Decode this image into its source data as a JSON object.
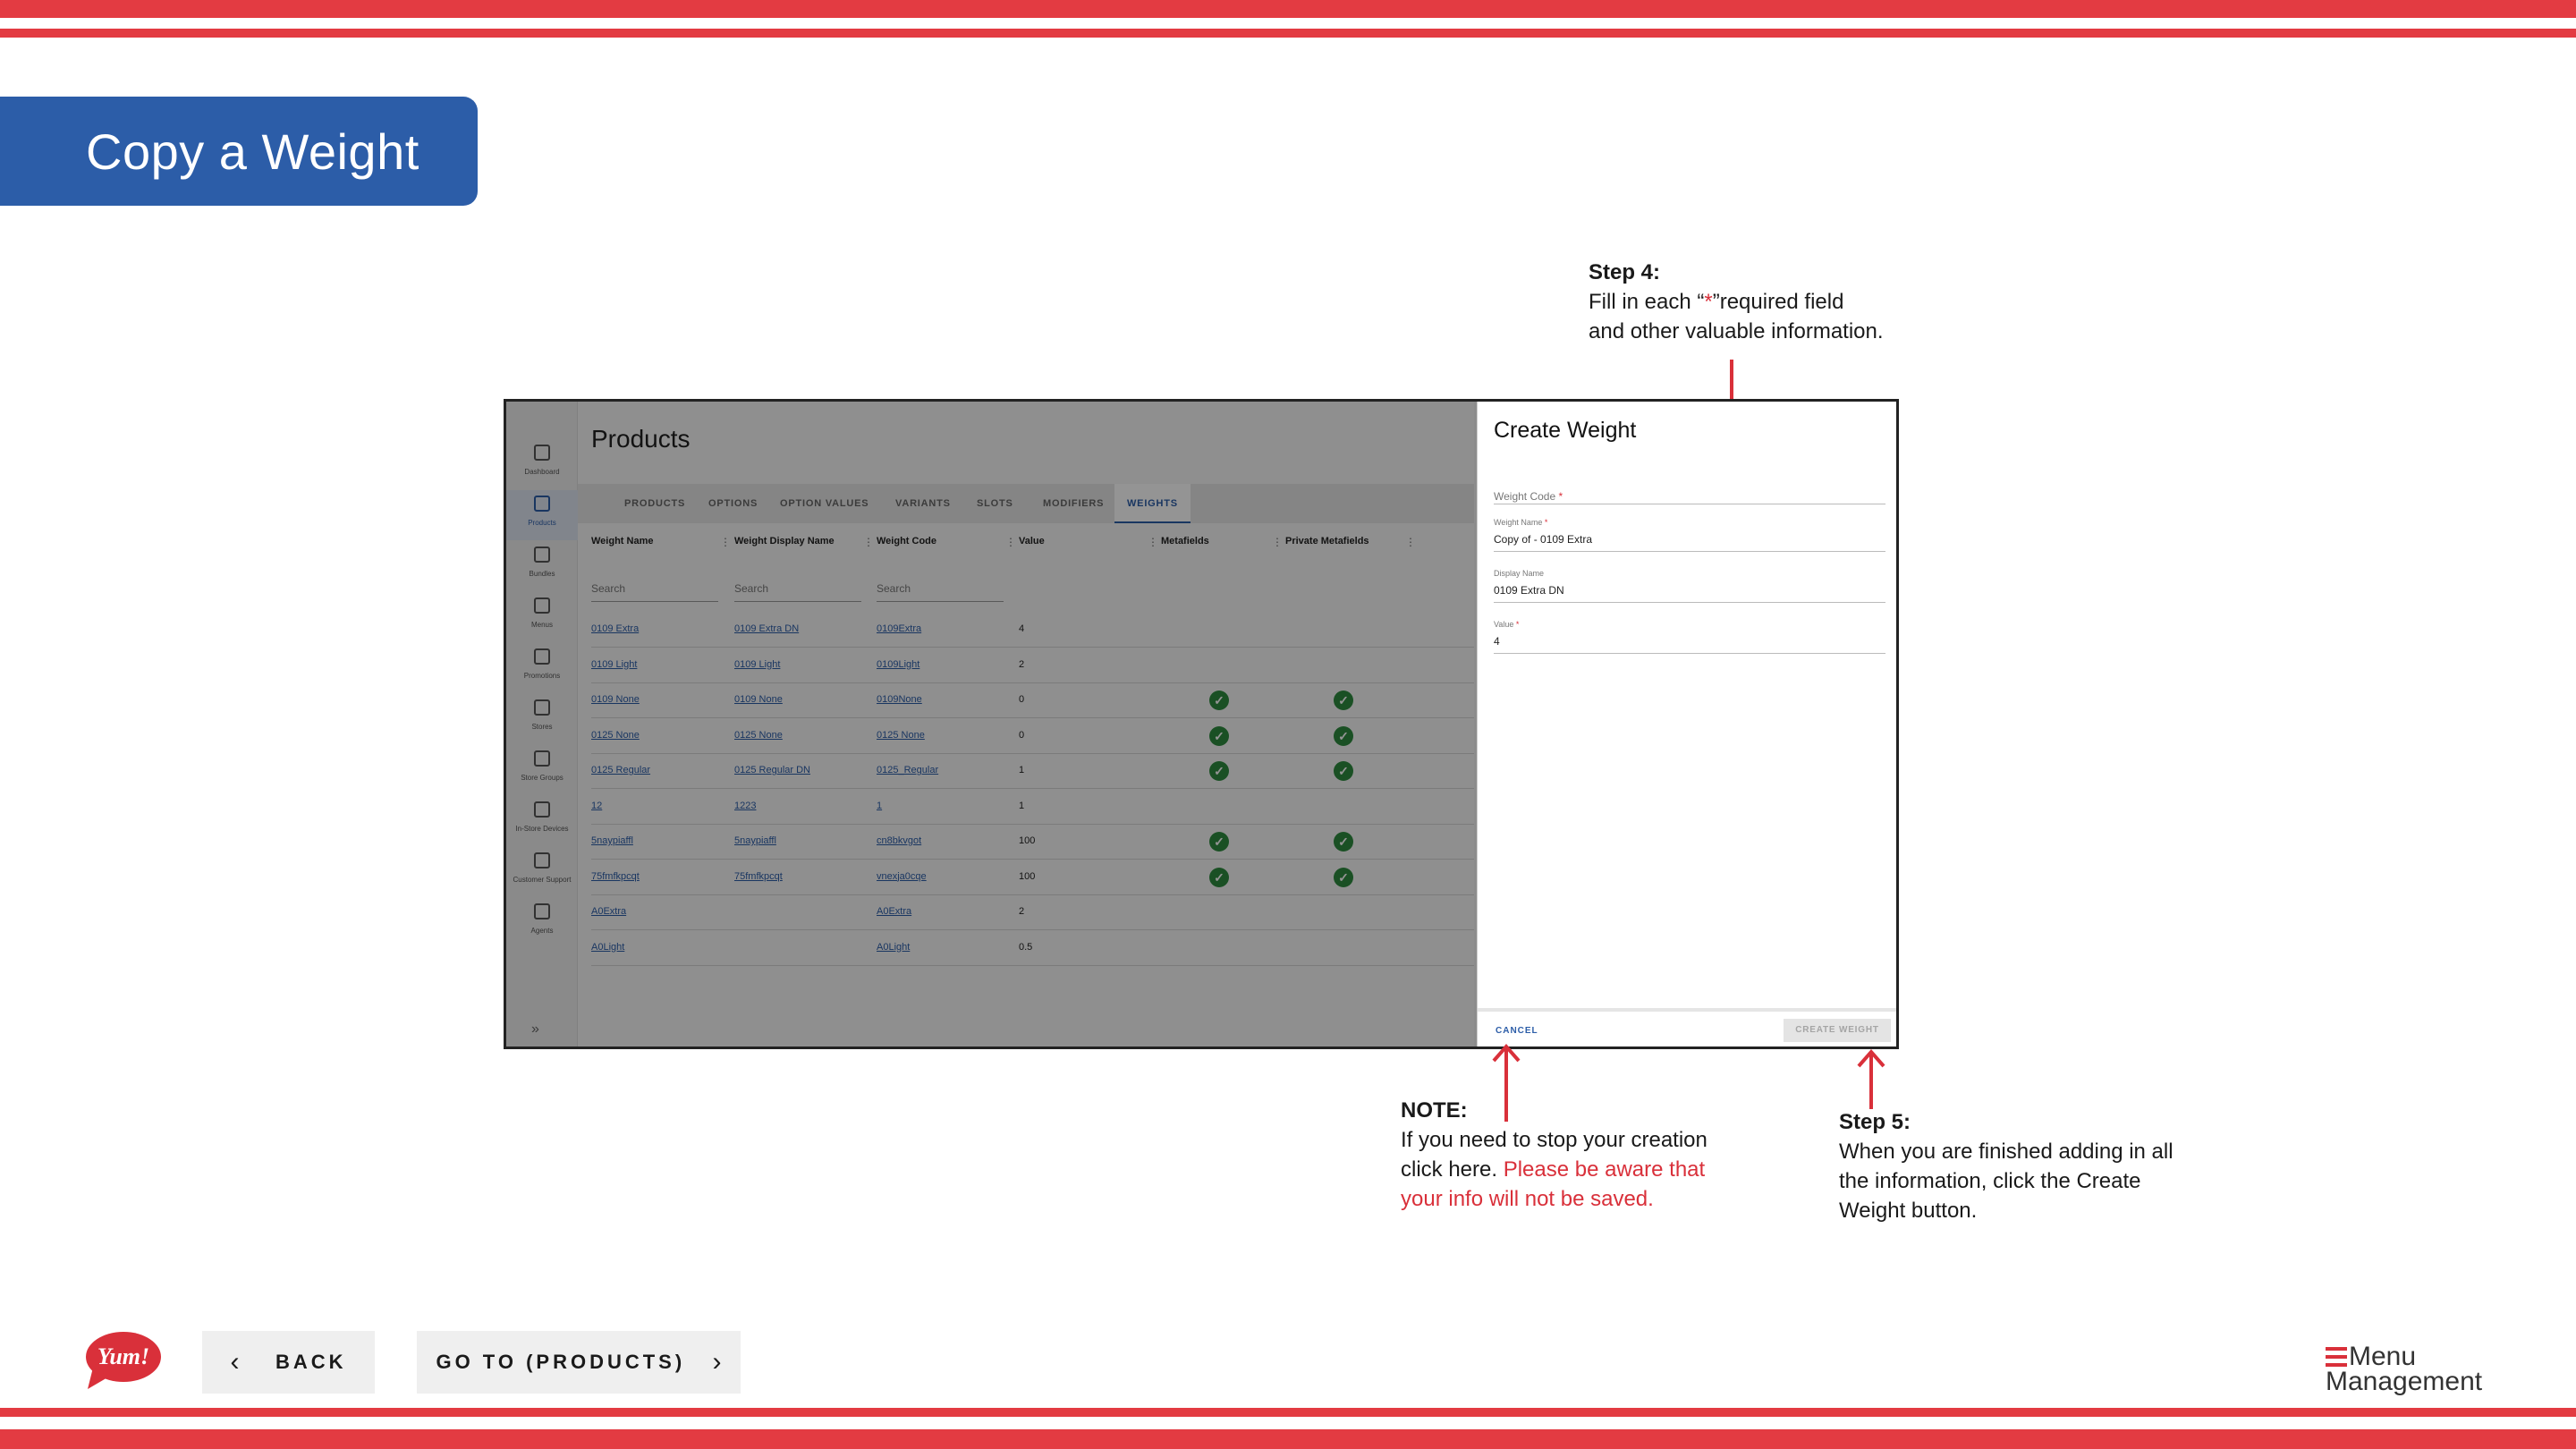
{
  "slide": {
    "title": "Copy a Weight",
    "step4": {
      "heading": "Step 4:",
      "line1_a": "Fill in each “",
      "asterisk": "*",
      "line1_b": "”required field",
      "line2": "and other valuable information."
    },
    "note": {
      "heading": "NOTE:",
      "line1": "If you need to stop your creation",
      "line2_a": "click here. ",
      "line2_b": "Please be aware that",
      "line3": "your info will not be saved."
    },
    "step5": {
      "heading": "Step 5:",
      "line1": "When you are finished adding in all",
      "line2": "the information, click the Create",
      "line3": "Weight button."
    },
    "back_label": "BACK",
    "goto_label": "GO TO (PRODUCTS)",
    "brand_logo": "Yum!",
    "mm_line1": "Menu",
    "mm_line2": "Management"
  },
  "colors": {
    "stripe": "#e33b42",
    "title_bg": "#2c5da8",
    "accent": "#2c5da8",
    "check": "#2e8b3e",
    "note_red": "#d9303a"
  },
  "app": {
    "page_title": "Products",
    "sidebar": [
      {
        "label": "Dashboard",
        "icon": "home-icon"
      },
      {
        "label": "Products",
        "icon": "bag-icon",
        "active": true
      },
      {
        "label": "Bundles",
        "icon": "box-icon"
      },
      {
        "label": "Menus",
        "icon": "document-icon"
      },
      {
        "label": "Promotions",
        "icon": "tag-icon"
      },
      {
        "label": "Stores",
        "icon": "store-icon"
      },
      {
        "label": "Store Groups",
        "icon": "grid-icon"
      },
      {
        "label": "In-Store Devices",
        "icon": "monitor-icon"
      },
      {
        "label": "Customer Support",
        "icon": "support-icon"
      },
      {
        "label": "Agents",
        "icon": "people-icon"
      }
    ],
    "expand_glyph": "»",
    "tabs": [
      "PRODUCTS",
      "OPTIONS",
      "OPTION VALUES",
      "VARIANTS",
      "SLOTS",
      "MODIFIERS",
      "WEIGHTS"
    ],
    "active_tab": "WEIGHTS",
    "columns": [
      "Weight Name",
      "Weight Display Name",
      "Weight Code",
      "Value",
      "Metafields",
      "Private Metafields"
    ],
    "search_placeholder": "Search",
    "rows": [
      {
        "name": "0109 Extra",
        "display": "0109 Extra DN",
        "code": "0109Extra",
        "value": "4",
        "meta": false,
        "pmeta": false
      },
      {
        "name": "0109 Light",
        "display": "0109 Light",
        "code": "0109Light",
        "value": "2",
        "meta": false,
        "pmeta": false
      },
      {
        "name": "0109 None",
        "display": "0109 None",
        "code": "0109None",
        "value": "0",
        "meta": true,
        "pmeta": true
      },
      {
        "name": "0125 None",
        "display": "0125 None",
        "code": "0125 None",
        "value": "0",
        "meta": true,
        "pmeta": true
      },
      {
        "name": "0125 Regular",
        "display": "0125 Regular DN",
        "code": "0125_Regular",
        "value": "1",
        "meta": true,
        "pmeta": true
      },
      {
        "name": "12",
        "display": "1223",
        "code": "1",
        "value": "1",
        "meta": false,
        "pmeta": false
      },
      {
        "name": "5naypiaffl",
        "display": "5naypiaffl",
        "code": "cn8bkvgot",
        "value": "100",
        "meta": true,
        "pmeta": true
      },
      {
        "name": "75fmfkpcqt",
        "display": "75fmfkpcqt",
        "code": "vnexja0cqe",
        "value": "100",
        "meta": true,
        "pmeta": true
      },
      {
        "name": "A0Extra",
        "display": "",
        "code": "A0Extra",
        "value": "2",
        "meta": false,
        "pmeta": false
      },
      {
        "name": "A0Light",
        "display": "",
        "code": "A0Light",
        "value": "0.5",
        "meta": false,
        "pmeta": false
      }
    ],
    "panel": {
      "title": "Create Weight",
      "weight_code_label": "Weight Code",
      "weight_name_label": "Weight Name",
      "weight_name_value": "Copy of - 0109 Extra",
      "display_name_label": "Display Name",
      "display_name_value": "0109 Extra DN",
      "value_label": "Value",
      "value_value": "4",
      "required_mark": "*",
      "cancel_label": "CANCEL",
      "create_label": "CREATE WEIGHT"
    }
  }
}
